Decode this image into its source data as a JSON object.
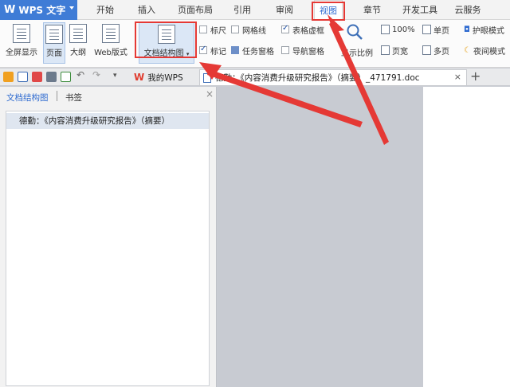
{
  "app": {
    "name": "WPS 文字",
    "logo": "W"
  },
  "menu": {
    "tabs": [
      {
        "label": "开始"
      },
      {
        "label": "插入"
      },
      {
        "label": "页面布局"
      },
      {
        "label": "引用"
      },
      {
        "label": "审阅"
      },
      {
        "label": "视图"
      },
      {
        "label": "章节"
      },
      {
        "label": "开发工具"
      },
      {
        "label": "云服务"
      }
    ],
    "active": "视图"
  },
  "ribbon": {
    "fullscreen": "全屏显示",
    "page": "页面",
    "outline": "大纲",
    "web": "Web版式",
    "doc_structure": "文档结构图",
    "ruler": "标尺",
    "gridlines": "网格线",
    "table_grid": "表格虚框",
    "marks": "标记",
    "task_pane": "任务窗格",
    "nav_pane": "导航窗格",
    "zoom": "显示比例",
    "hundred": "100%",
    "page_width": "页宽",
    "one_page": "单页",
    "multi_page": "多页",
    "eye_mode": "护眼模式",
    "night_mode": "夜间模式"
  },
  "tabbar": {
    "my_wps": "我的WPS",
    "doc_title": "德勤：《内容消费升级研究报告》（摘要）_471791.doc",
    "close": "×",
    "add": "+"
  },
  "nav": {
    "tab_outline": "文档结构图",
    "tab_bookmark": "书签",
    "close": "×",
    "item": "德勤：《内容消费升级研究报告》（摘要）"
  },
  "colors": {
    "accent": "#3f7cd6",
    "highlight": "#e53935",
    "active_tab": "#2f6bd0"
  }
}
